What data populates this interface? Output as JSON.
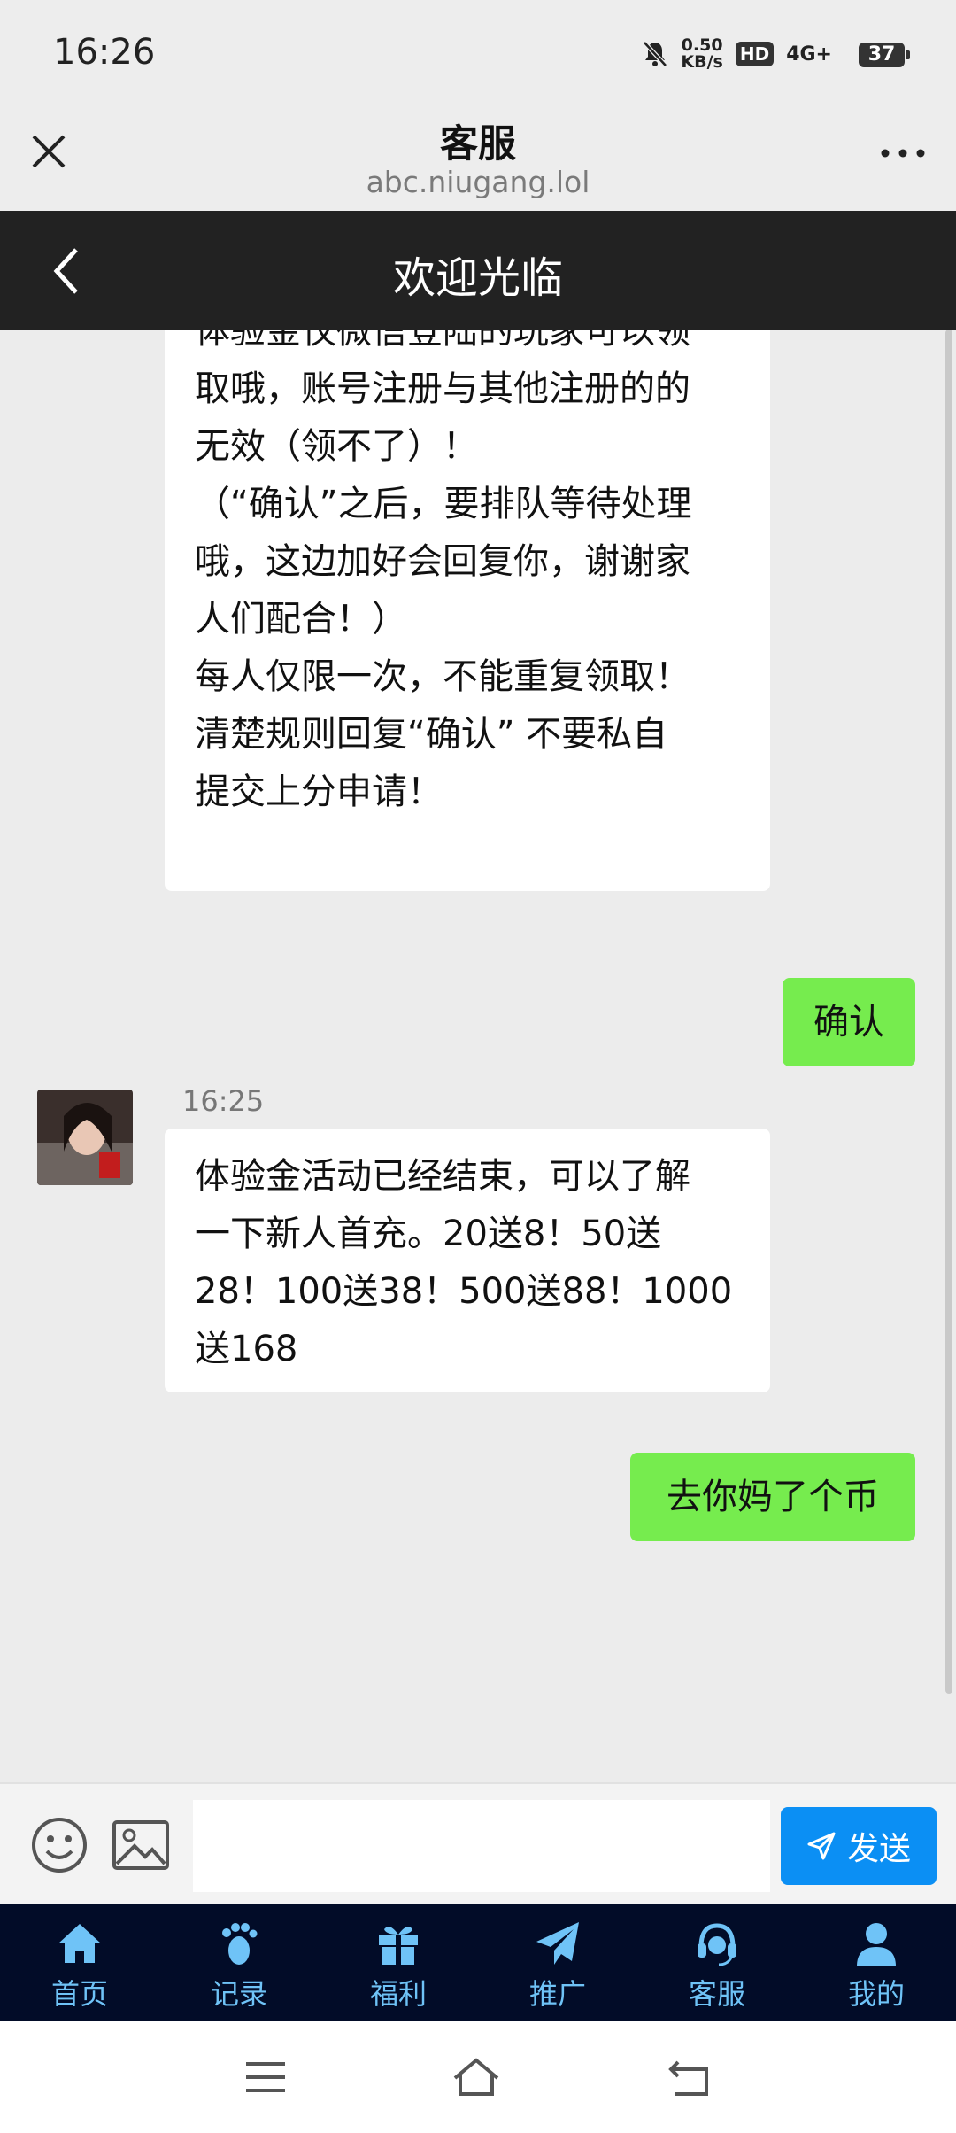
{
  "status": {
    "time": "16:26",
    "net_speed_top": "0.50",
    "net_speed_bottom": "KB/s",
    "hd": "HD",
    "signal": "4G+",
    "battery": "37"
  },
  "browser": {
    "title": "客服",
    "url": "abc.niugang.lol"
  },
  "app": {
    "title": "欢迎光临"
  },
  "chat": {
    "messages": [
      {
        "from": "agent",
        "lines": [
          "体验金仅微信登陆的玩家可以领",
          "取哦，账号注册与其他注册的的",
          "无效（领不了）！",
          "（“确认”之后，要排队等待处理",
          "哦，这边加好会回复你，谢谢家",
          "人们配合！）",
          "每人仅限一次，不能重复领取！",
          "清楚规则回复“确认”  不要私自",
          "提交上分申请！"
        ]
      },
      {
        "from": "user",
        "text": "确认"
      },
      {
        "from": "agent",
        "time": "16:25",
        "lines": [
          "体验金活动已经结束，可以了解",
          "一下新人首充。20送8！50送",
          "28！100送38！500送88！1000",
          "送168"
        ]
      },
      {
        "from": "user",
        "text": "去你妈了个币"
      }
    ]
  },
  "input": {
    "value": "",
    "send_label": "发送"
  },
  "nav": [
    {
      "label": "首页",
      "icon": "home-icon"
    },
    {
      "label": "记录",
      "icon": "footprint-icon"
    },
    {
      "label": "福利",
      "icon": "gift-icon"
    },
    {
      "label": "推广",
      "icon": "paper-plane-icon"
    },
    {
      "label": "客服",
      "icon": "headset-icon"
    },
    {
      "label": "我的",
      "icon": "user-icon"
    }
  ],
  "colors": {
    "accent_blue": "#0b8ff4",
    "user_bubble": "#76ec4e",
    "nav_bg": "#020c28",
    "nav_text": "#6fc3f7"
  }
}
